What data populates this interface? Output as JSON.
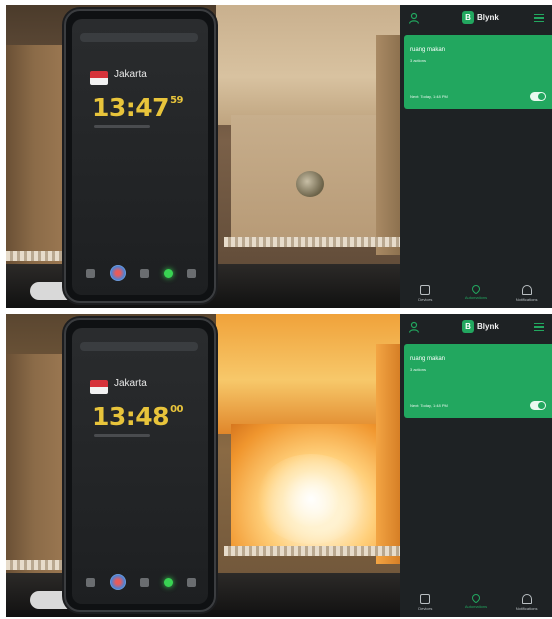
{
  "frames": [
    {
      "phone": {
        "city": "Jakarta",
        "time_hm": "13:47",
        "time_sec": "59"
      },
      "light": "off"
    },
    {
      "phone": {
        "city": "Jakarta",
        "time_hm": "13:48",
        "time_sec": "00"
      },
      "light": "on"
    }
  ],
  "app": {
    "brand": "Blynk",
    "brand_logo_letter": "B",
    "automation": {
      "name": "ruang makan",
      "actions": "3 actions",
      "next": "Next: Today, 1:48 PM",
      "enabled": true
    },
    "nav": {
      "devices": "Devices",
      "automations": "Automations",
      "notifications": "Notifications"
    },
    "colors": {
      "accent": "#22a75f",
      "background": "#1e2224",
      "clock": "#e8c43b"
    }
  }
}
